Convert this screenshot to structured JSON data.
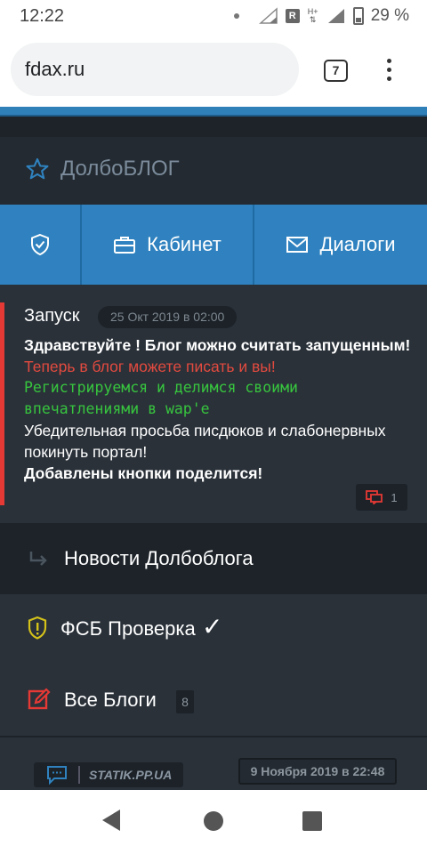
{
  "status_bar": {
    "time": "12:22",
    "battery": "29 %"
  },
  "browser": {
    "url": "fdax.ru",
    "tab_count": "7"
  },
  "site": {
    "brand": "ДолбоБЛОГ",
    "nav": {
      "cabinet": "Кабинет",
      "dialogs": "Диалоги"
    }
  },
  "post": {
    "title": "Запуск",
    "date": "25 Окт 2019 в 02:00",
    "line1": "Здравствуйте ! Блог можно считать запущенным!",
    "line2": "Теперь в блог можете писать и вы!",
    "line3": "Регистрируемся и делимся своими впечатлениями в wap'е",
    "line4": "Убедительная просьба писдюков и слабонервных покинуть портал!",
    "line5": "Добавлены кнопки поделится!",
    "comments": "1"
  },
  "menu": {
    "news": "Новости Долбоблога",
    "fsb": "ФСБ Проверка",
    "fsb_check": "✓",
    "all_blogs": "Все Блоги",
    "all_blogs_count": "8"
  },
  "footer": {
    "statik": "STATIK.PP.UA",
    "date": "9 Ноября 2019 в 22:48"
  },
  "colors": {
    "accent_blue": "#2f82bf",
    "post_accent": "#e53935",
    "green_text": "#37c43e",
    "red_text": "#e24a3f",
    "fsb_icon": "#d4c21a",
    "blogs_icon": "#e53935"
  }
}
